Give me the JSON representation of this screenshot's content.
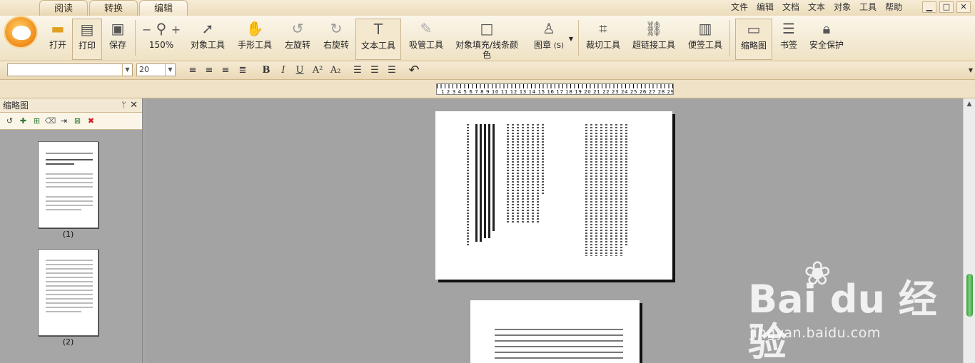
{
  "tabs": [
    "阅读",
    "转换",
    "编辑"
  ],
  "menu": [
    "文件",
    "编辑",
    "文档",
    "文本",
    "对象",
    "工具",
    "帮助"
  ],
  "window_buttons": [
    "▁",
    "□",
    "✕"
  ],
  "toolbar": {
    "open": "打开",
    "print": "打印",
    "save": "保存",
    "zoom_minus": "−",
    "zoom_plus": "+",
    "zoom_value": "150%",
    "object_tool": "对象工具",
    "hand_tool": "手形工具",
    "rotate_left": "左旋转",
    "rotate_right": "右旋转",
    "text_tool": "文本工具",
    "eyedropper": "吸管工具",
    "fill_line_1": "对象填充/线条颜",
    "fill_line_2": "色",
    "stamp": "图章",
    "stamp_shortcut": "(S)",
    "crop": "裁切工具",
    "hyperlink": "超链接工具",
    "note": "便签工具",
    "thumbnail": "缩略图",
    "bookmark": "书签",
    "security": "安全保护"
  },
  "format": {
    "font_name": "",
    "font_size": "20",
    "bold": "B",
    "italic": "I",
    "underline": "U",
    "superscript": "A²",
    "subscript": "A₂"
  },
  "ruler": {
    "labels": "1 2 3 4 5 6 7 8 9 10 11 12 13 14 15 16 17 18 19 20 21 22 23 24 25 26 27 28 29"
  },
  "panel": {
    "title": "缩略图",
    "pin": "ᛘ",
    "close": "✕",
    "page_labels": [
      "(1)",
      "(2)"
    ]
  },
  "watermark": {
    "brand": "Bai du 经验",
    "url": "jingyan.baidu.com"
  },
  "colors": {
    "toolbar_bg": "#efe2c4",
    "accent_orange": "#f08a18",
    "viewer_bg": "#a3a3a3",
    "scroll_green": "#3a9d3a"
  }
}
